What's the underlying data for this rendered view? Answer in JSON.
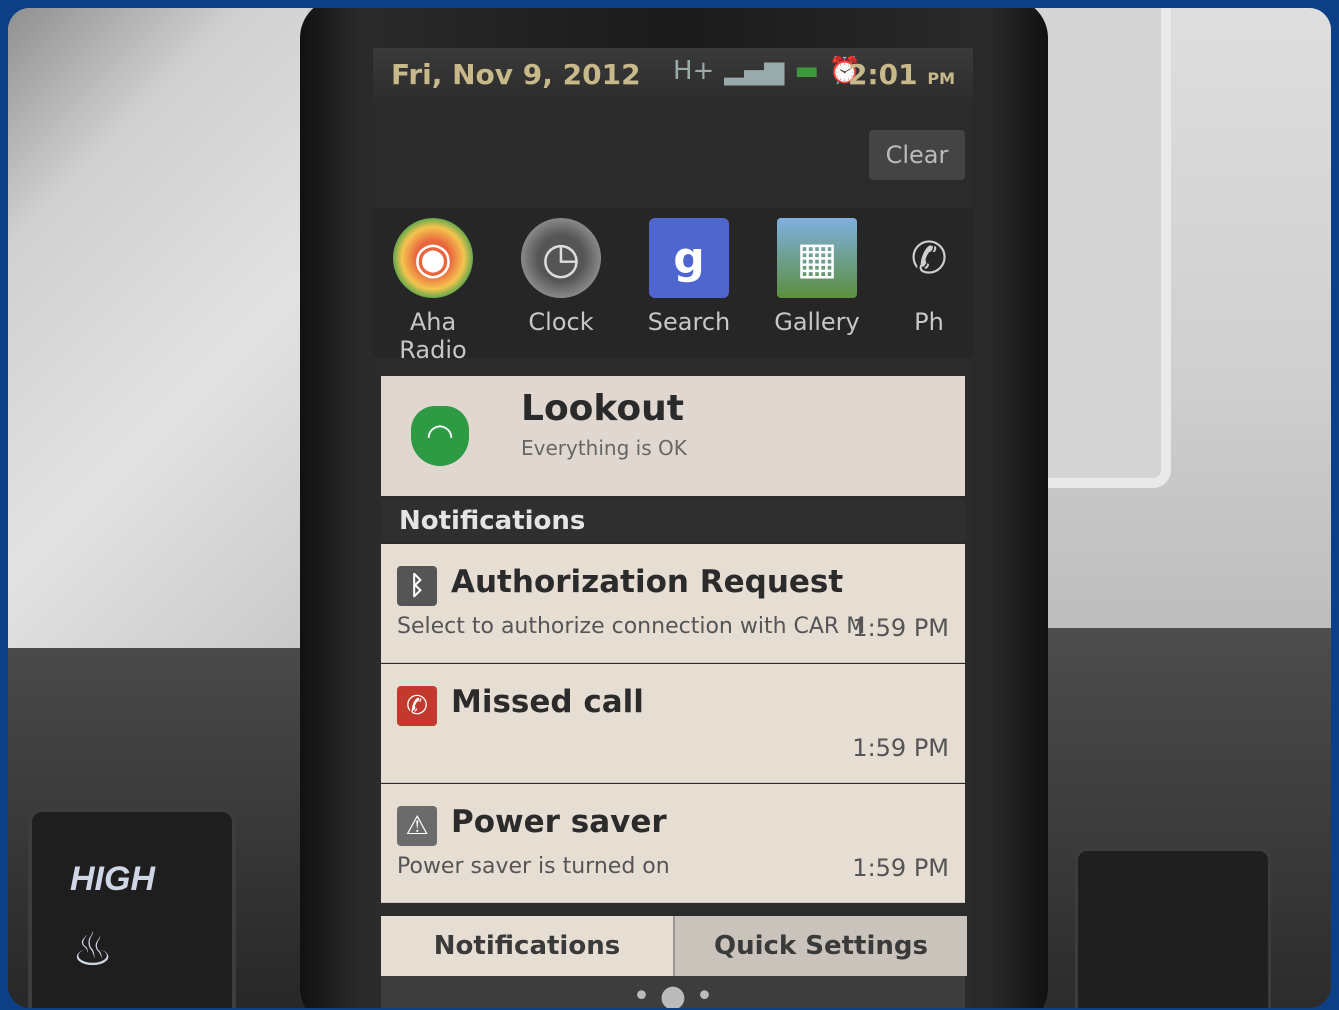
{
  "status_bar": {
    "date": "Fri, Nov 9, 2012",
    "network": "H+",
    "time": "2:01",
    "ampm": "PM"
  },
  "clear_label": "Clear",
  "apps": [
    {
      "label": "Aha Radio",
      "icon": "aha-radio-icon",
      "glyph": "◉"
    },
    {
      "label": "Clock",
      "icon": "clock-icon",
      "glyph": "◷"
    },
    {
      "label": "Search",
      "icon": "search-icon",
      "glyph": "g"
    },
    {
      "label": "Gallery",
      "icon": "gallery-icon",
      "glyph": "▦"
    },
    {
      "label": "Ph",
      "icon": "phone-icon",
      "glyph": "✆"
    }
  ],
  "lookout": {
    "title": "Lookout",
    "subtitle": "Everything is OK"
  },
  "notifications_header": "Notifications",
  "notifications": [
    {
      "title": "Authorization Request",
      "text": "Select to authorize connection with CAR M",
      "time": "1:59 PM",
      "icon": "bluetooth-icon",
      "color": "#555555"
    },
    {
      "title": "Missed call",
      "text": "",
      "time": "1:59 PM",
      "icon": "missed-call-icon",
      "color": "#c23a2e"
    },
    {
      "title": "Power saver",
      "text": "Power saver is turned on",
      "time": "1:59 PM",
      "icon": "warning-icon",
      "color": "#6b6b6b"
    }
  ],
  "tabs": {
    "notifications": "Notifications",
    "quick_settings": "Quick Settings"
  },
  "car": {
    "seat_heat_label": "HIGH"
  }
}
